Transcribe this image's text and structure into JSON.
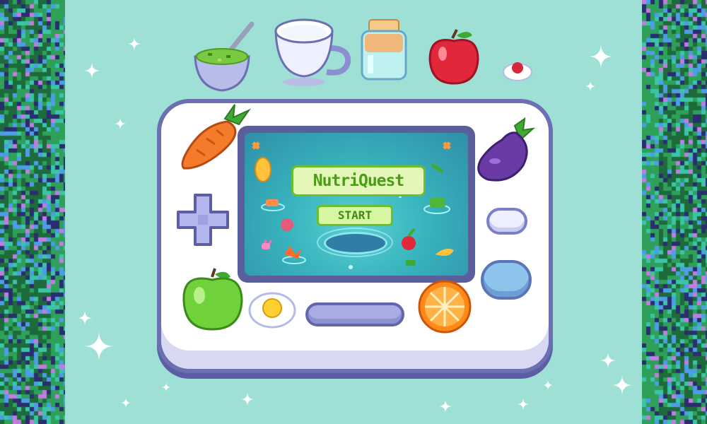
{
  "game": {
    "title": "NutriQuest",
    "start_label": "START"
  },
  "colors": {
    "background": "#9fe0d6",
    "console_body": "#ffffff",
    "console_outline": "#6c6fb2",
    "screen_water": "#38b3bd",
    "title_green": "#4c9b17",
    "border_palette": [
      "#1d6b3a",
      "#2fa05a",
      "#3bc4a6",
      "#4d9de6",
      "#c27be0",
      "#2a2e6e"
    ]
  },
  "icons": [
    "green-soup-bowl-icon",
    "milk-cup-icon",
    "juice-jar-icon",
    "red-apple-icon",
    "cherry-icon",
    "carrot-icon",
    "eggplant-icon",
    "green-apple-icon",
    "fried-egg-icon",
    "orange-slice-icon",
    "sparkle-icon",
    "dpad-icon"
  ]
}
